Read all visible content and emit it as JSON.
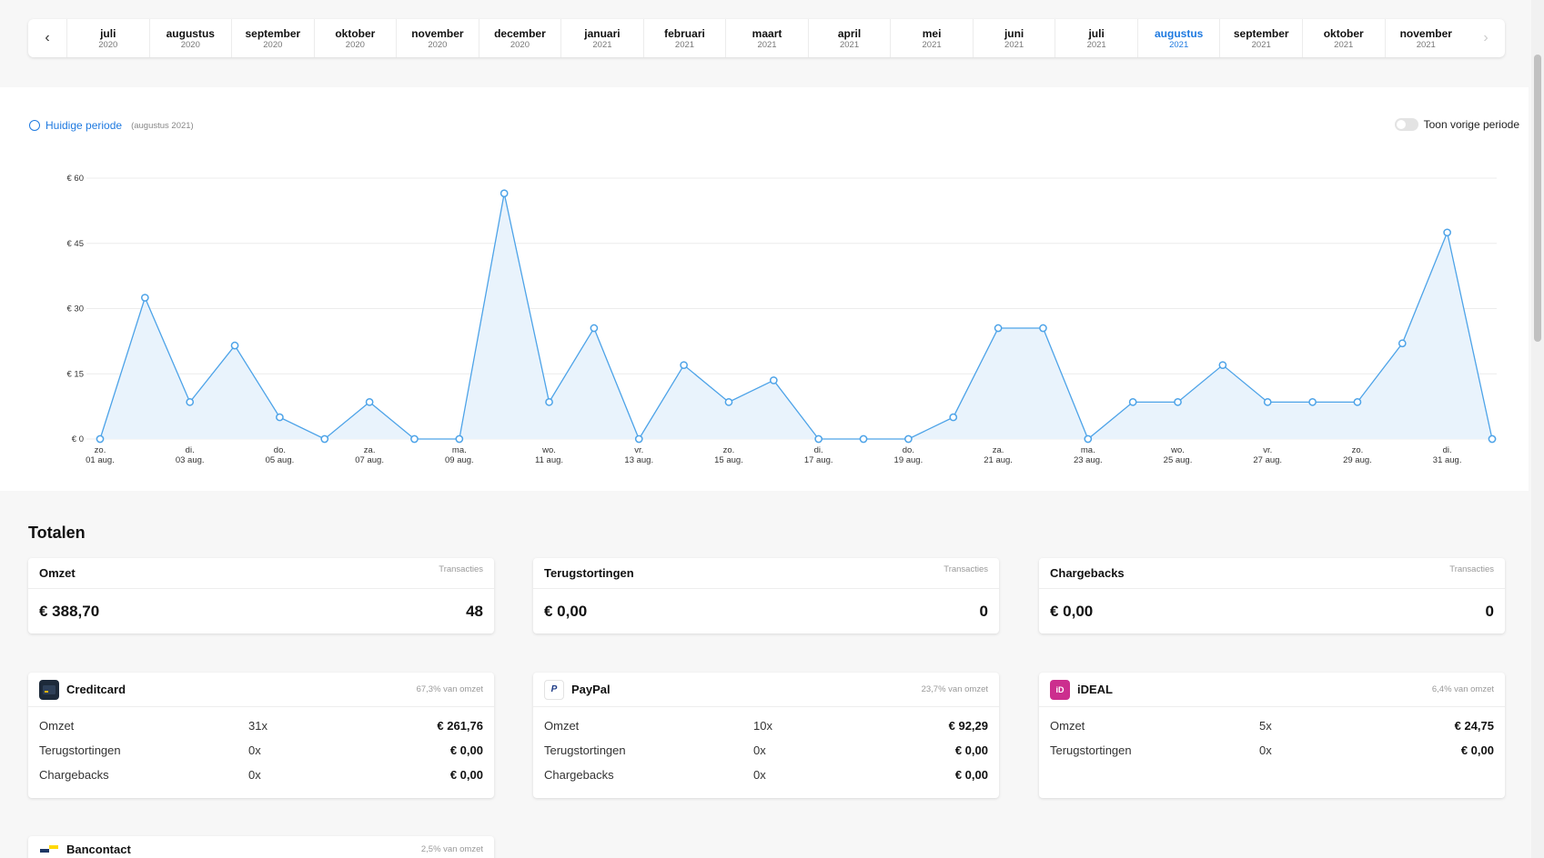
{
  "month_nav": {
    "prev_icon": "chevron-left-icon",
    "next_icon": "chevron-right-icon",
    "months": [
      {
        "name": "juli",
        "year": "2020"
      },
      {
        "name": "augustus",
        "year": "2020"
      },
      {
        "name": "september",
        "year": "2020"
      },
      {
        "name": "oktober",
        "year": "2020"
      },
      {
        "name": "november",
        "year": "2020"
      },
      {
        "name": "december",
        "year": "2020"
      },
      {
        "name": "januari",
        "year": "2021"
      },
      {
        "name": "februari",
        "year": "2021"
      },
      {
        "name": "maart",
        "year": "2021"
      },
      {
        "name": "april",
        "year": "2021"
      },
      {
        "name": "mei",
        "year": "2021"
      },
      {
        "name": "juni",
        "year": "2021"
      },
      {
        "name": "juli",
        "year": "2021"
      },
      {
        "name": "augustus",
        "year": "2021",
        "active": true
      },
      {
        "name": "september",
        "year": "2021"
      },
      {
        "name": "oktober",
        "year": "2021"
      },
      {
        "name": "november",
        "year": "2021"
      }
    ],
    "active_color": "#1f7ae0"
  },
  "chart_header": {
    "current_label": "Huidige periode",
    "current_sub": "(augustus 2021)",
    "toggle_label": "Toon vorige periode"
  },
  "chart_data": {
    "type": "area",
    "color": "#4da3e8",
    "fill": "#e9f3fc",
    "ylim": [
      0,
      60
    ],
    "yticks": [
      "€ 0",
      "€ 15",
      "€ 30",
      "€ 45",
      "€ 60"
    ],
    "ytick_values": [
      0,
      15,
      30,
      45,
      60
    ],
    "x": [
      1,
      2,
      3,
      4,
      5,
      6,
      7,
      8,
      9,
      10,
      11,
      12,
      13,
      14,
      15,
      16,
      17,
      18,
      19,
      20,
      21,
      22,
      23,
      24,
      25,
      26,
      27,
      28,
      29,
      30,
      31,
      32
    ],
    "values": [
      0,
      32.5,
      8.5,
      21.5,
      5,
      0,
      8.5,
      0,
      0,
      56.5,
      8.5,
      25.5,
      0,
      17,
      8.5,
      13.5,
      0,
      0,
      0,
      5,
      25.5,
      25.5,
      0,
      8.5,
      8.5,
      17,
      8.5,
      8.5,
      8.5,
      22,
      47.5,
      0
    ],
    "xtick_labels": [
      {
        "day": "zo.",
        "date": "01 aug."
      },
      {
        "day": "di.",
        "date": "03 aug."
      },
      {
        "day": "do.",
        "date": "05 aug."
      },
      {
        "day": "za.",
        "date": "07 aug."
      },
      {
        "day": "ma.",
        "date": "09 aug."
      },
      {
        "day": "wo.",
        "date": "11 aug."
      },
      {
        "day": "vr.",
        "date": "13 aug."
      },
      {
        "day": "zo.",
        "date": "15 aug."
      },
      {
        "day": "di.",
        "date": "17 aug."
      },
      {
        "day": "do.",
        "date": "19 aug."
      },
      {
        "day": "za.",
        "date": "21 aug."
      },
      {
        "day": "ma.",
        "date": "23 aug."
      },
      {
        "day": "wo.",
        "date": "25 aug."
      },
      {
        "day": "vr.",
        "date": "27 aug."
      },
      {
        "day": "zo.",
        "date": "29 aug."
      },
      {
        "day": "di.",
        "date": "31 aug."
      }
    ],
    "grid": true
  },
  "totals": {
    "title": "Totalen",
    "cards": [
      {
        "title": "Omzet",
        "sub": "Transacties",
        "value": "€ 388,70",
        "count": "48"
      },
      {
        "title": "Terugstortingen",
        "sub": "Transacties",
        "value": "€ 0,00",
        "count": "0"
      },
      {
        "title": "Chargebacks",
        "sub": "Transacties",
        "value": "€ 0,00",
        "count": "0"
      }
    ]
  },
  "payment_methods": [
    {
      "name": "Creditcard",
      "share": "67,3% van omzet",
      "icon": "creditcard-icon",
      "rows": [
        {
          "label": "Omzet",
          "count": "31x",
          "amount": "€ 261,76"
        },
        {
          "label": "Terugstortingen",
          "count": "0x",
          "amount": "€ 0,00"
        },
        {
          "label": "Chargebacks",
          "count": "0x",
          "amount": "€ 0,00"
        }
      ]
    },
    {
      "name": "PayPal",
      "share": "23,7% van omzet",
      "icon": "paypal-icon",
      "rows": [
        {
          "label": "Omzet",
          "count": "10x",
          "amount": "€ 92,29"
        },
        {
          "label": "Terugstortingen",
          "count": "0x",
          "amount": "€ 0,00"
        },
        {
          "label": "Chargebacks",
          "count": "0x",
          "amount": "€ 0,00"
        }
      ]
    },
    {
      "name": "iDEAL",
      "share": "6,4% van omzet",
      "icon": "ideal-icon",
      "rows": [
        {
          "label": "Omzet",
          "count": "5x",
          "amount": "€ 24,75"
        },
        {
          "label": "Terugstortingen",
          "count": "0x",
          "amount": "€ 0,00"
        }
      ]
    }
  ],
  "bancontact": {
    "name": "Bancontact",
    "share": "2,5% van omzet",
    "icon": "bancontact-icon"
  }
}
